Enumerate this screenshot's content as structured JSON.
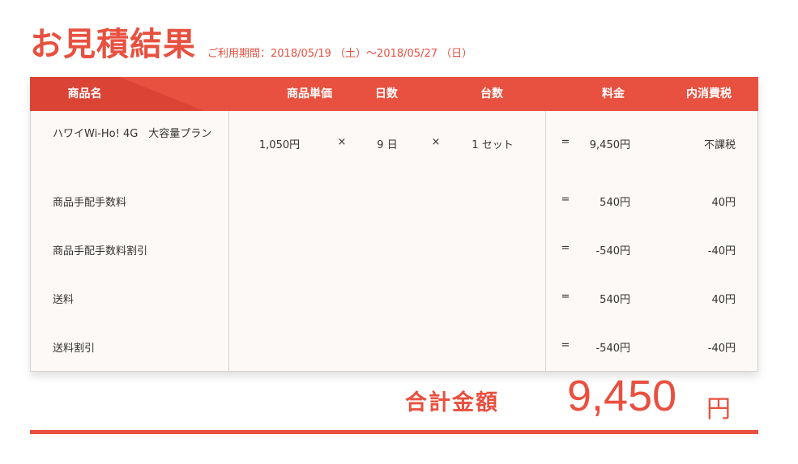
{
  "header": {
    "title": "お見積結果",
    "period": "ご利用期間：2018/05/19 （土）～2018/05/27 （日）"
  },
  "table": {
    "headers": {
      "product": "商品名",
      "unit_price": "商品単価",
      "days": "日数",
      "count": "台数",
      "fee": "料金",
      "tax": "内消費税"
    },
    "rows": [
      {
        "name": "ハワイWi-Ho! 4G　大容量プラン",
        "unit_price": "1,050円",
        "times1": "×",
        "days": "9 日",
        "times2": "×",
        "count": "1 セット",
        "equals": "=",
        "fee": "9,450円",
        "tax": "不課税"
      },
      {
        "name": "商品手配手数料",
        "equals": "=",
        "fee": "540円",
        "tax": "40円"
      },
      {
        "name": "商品手配手数料割引",
        "equals": "=",
        "fee": "-540円",
        "tax": "-40円"
      },
      {
        "name": "送料",
        "equals": "=",
        "fee": "540円",
        "tax": "40円"
      },
      {
        "name": "送料割引",
        "equals": "=",
        "fee": "-540円",
        "tax": "-40円"
      }
    ]
  },
  "total": {
    "label": "合計金額",
    "amount": "9,450",
    "unit": "円"
  },
  "colors": {
    "accent": "#e8503f",
    "table_bg": "#fdf9f6",
    "border": "#d6d2cf"
  }
}
